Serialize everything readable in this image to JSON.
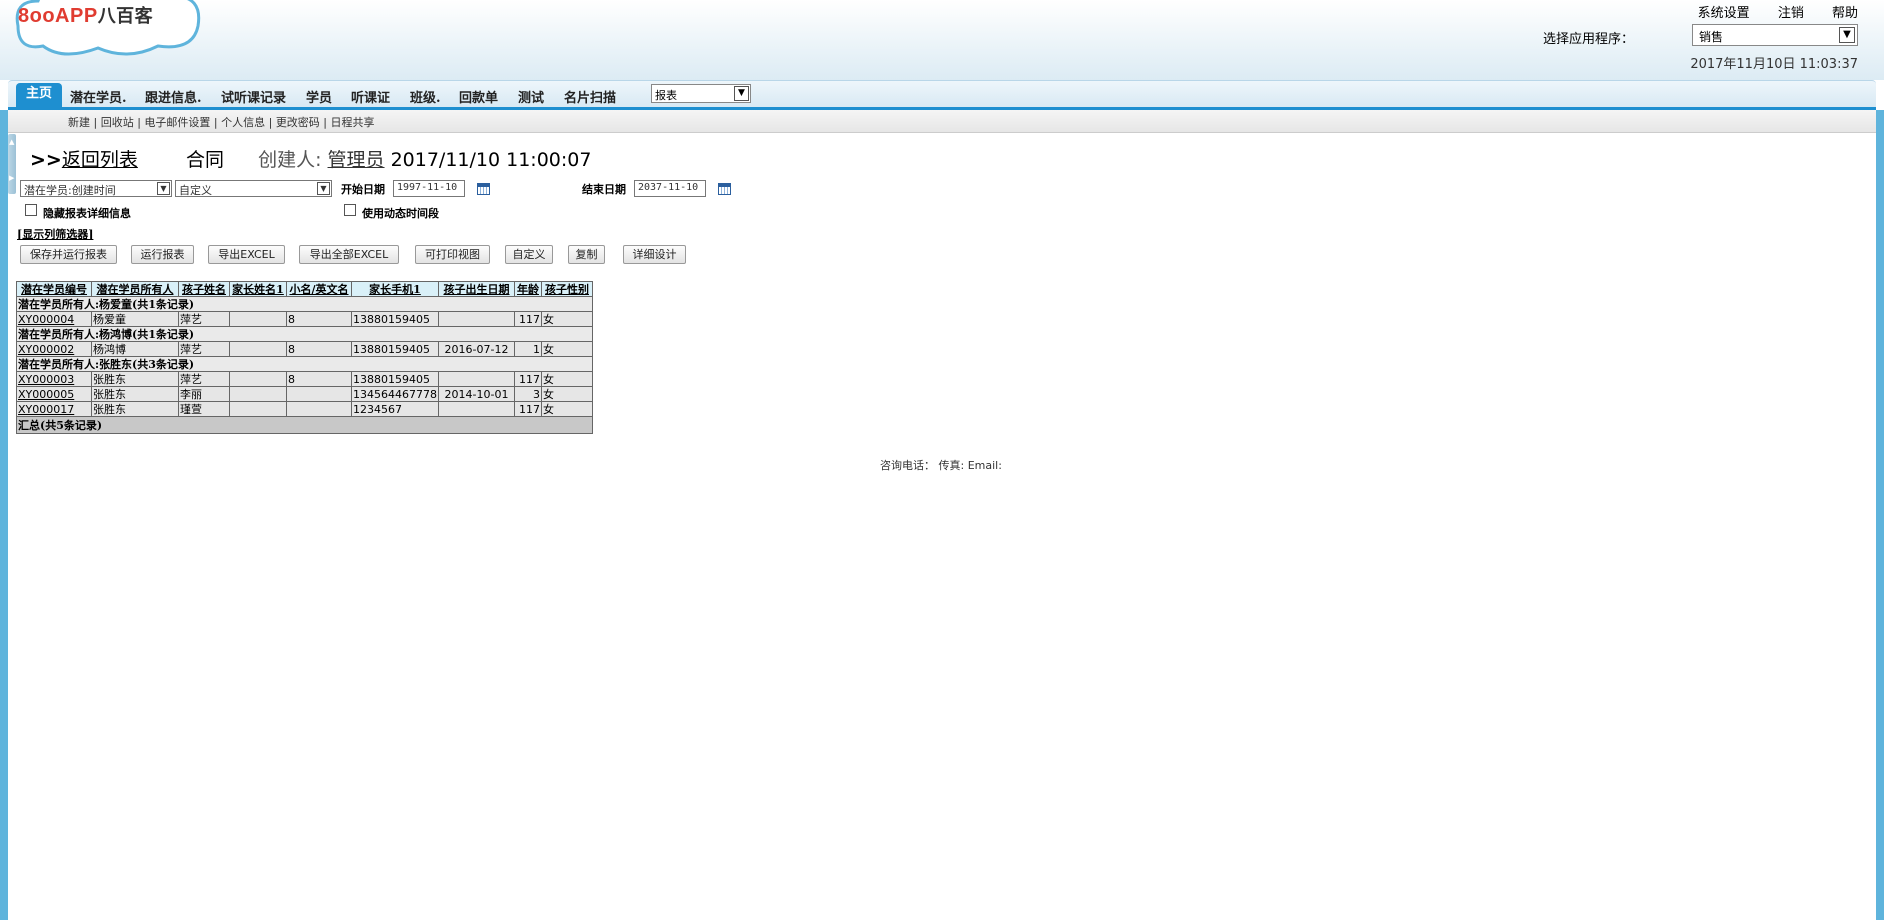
{
  "header": {
    "logo_text": "8ooAPP",
    "logo_cn": "八百客",
    "links": [
      "系统设置",
      "注销",
      "帮助"
    ],
    "app_select_label": "选择应用程序：",
    "app_select_value": "销售",
    "datetime": "2017年11月10日 11:03:37"
  },
  "nav": {
    "items": [
      "主页",
      "潜在学员.",
      "跟进信息.",
      "试听课记录",
      "学员",
      "听课证",
      "班级.",
      "回款单",
      "测试",
      "名片扫描"
    ],
    "active_index": 0,
    "report_select_value": "报表"
  },
  "subnav": {
    "links": [
      "新建",
      "回收站",
      "电子邮件设置",
      "个人信息",
      "更改密码",
      "日程共享"
    ]
  },
  "title": {
    "back_prefix": ">>",
    "back_link": "返回列表",
    "object": "合同",
    "creator_label": "创建人:",
    "creator_name": "管理员",
    "created_at": "2017/11/10 11:00:07"
  },
  "filters": {
    "date_field": "潜在学员:创建时间",
    "range": "自定义",
    "start_label": "开始日期",
    "start_value": "1997-11-10",
    "end_label": "结束日期",
    "end_value": "2037-11-10",
    "hide_details_label": "隐藏报表详细信息",
    "dynamic_range_label": "使用动态时间段",
    "show_filter_link": "[显示列筛选器]"
  },
  "buttons": [
    "保存并运行报表",
    "运行报表",
    "导出EXCEL",
    "导出全部EXCEL",
    "可打印视图",
    "自定义",
    "复制",
    "详细设计"
  ],
  "table": {
    "columns": [
      "潜在学员编号",
      "潜在学员所有人",
      "孩子姓名",
      "家长姓名1",
      "小名/英文名",
      "家长手机1",
      "孩子出生日期",
      "年龄",
      "孩子性别"
    ],
    "groups": [
      {
        "label": "潜在学员所有人:杨爱童(共1条记录)",
        "rows": [
          [
            "XY000004",
            "杨爱童",
            "萍艺",
            "",
            "8",
            "13880159405",
            "",
            "117",
            "女"
          ]
        ]
      },
      {
        "label": "潜在学员所有人:杨鸿博(共1条记录)",
        "rows": [
          [
            "XY000002",
            "杨鸿博",
            "萍艺",
            "",
            "8",
            "13880159405",
            "2016-07-12",
            "1",
            "女"
          ]
        ]
      },
      {
        "label": "潜在学员所有人:张胜东(共3条记录)",
        "rows": [
          [
            "XY000003",
            "张胜东",
            "萍艺",
            "",
            "8",
            "13880159405",
            "",
            "117",
            "女"
          ],
          [
            "XY000005",
            "张胜东",
            "李丽",
            "",
            "",
            "134564467778",
            "2014-10-01",
            "3",
            "女"
          ],
          [
            "XY000017",
            "张胜东",
            "瑾萱",
            "",
            "",
            "1234567",
            "",
            "117",
            "女"
          ]
        ]
      }
    ],
    "total": "汇总(共5条记录)"
  },
  "footer": {
    "text": "咨询电话：  传真: Email:"
  },
  "colors": {
    "accent": "#1e8fd0",
    "header_bg": "#d9f0f8",
    "border_blue": "#5fb4dc"
  }
}
